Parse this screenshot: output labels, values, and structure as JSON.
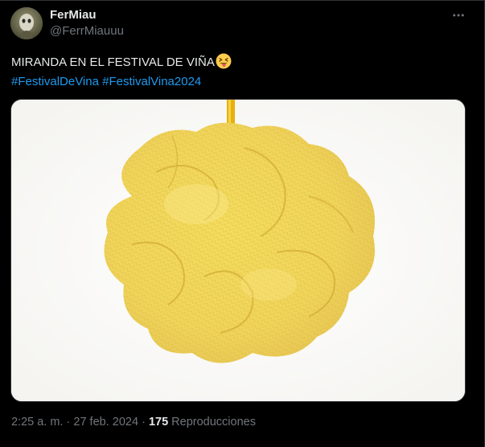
{
  "tweet": {
    "author": {
      "display_name": "FerMiau",
      "username": "@FerrMiauuu",
      "avatar_icon": "avatar-photo"
    },
    "more_icon": "more-options-icon",
    "text": {
      "main": "MIRANDA EN EL FESTIVAL DE VIÑA",
      "emoji": "😝",
      "hashtags": [
        "#FestivalDeVina",
        "#FestivalVina2024"
      ]
    },
    "media": {
      "icon": "yellow-bath-sponge-image"
    },
    "meta": {
      "time": "2:25 a. m.",
      "separator": "·",
      "date": "27 feb. 2024",
      "views_count": "175",
      "views_label": "Reproducciones"
    }
  },
  "colors": {
    "background": "#000000",
    "text": "#e7e9ea",
    "secondary_text": "#71767b",
    "link": "#1d9bf0",
    "border": "#2f3336"
  }
}
